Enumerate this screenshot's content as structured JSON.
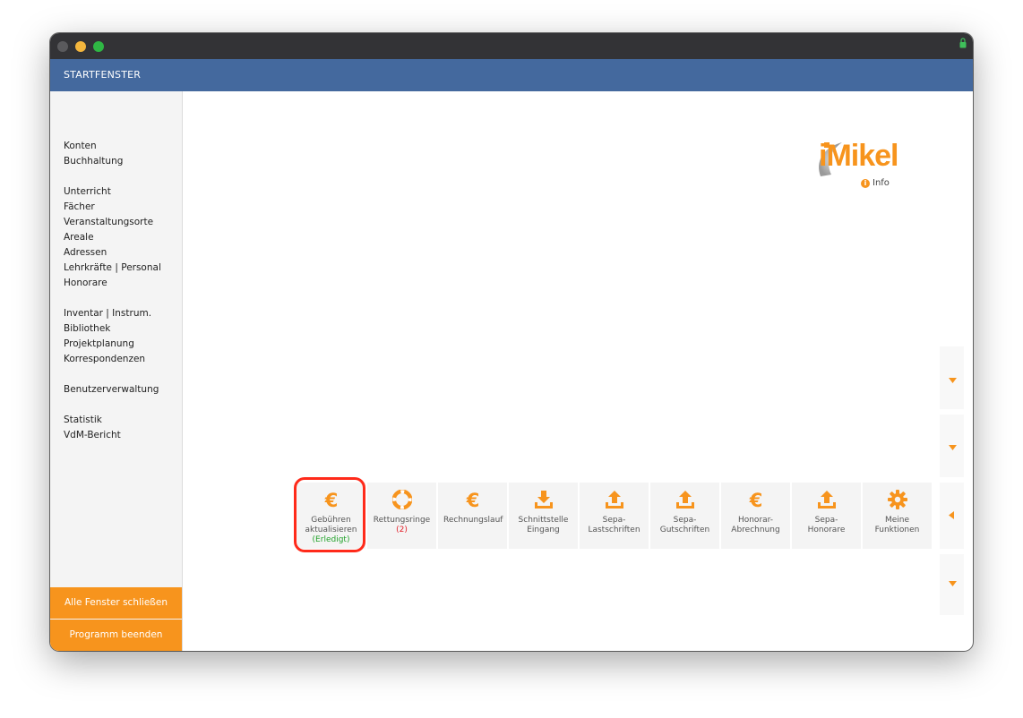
{
  "window": {
    "title": "STARTFENSTER"
  },
  "sidebar": {
    "groups": [
      [
        "Konten",
        "Buchhaltung"
      ],
      [
        "Unterricht",
        "Fächer",
        "Veranstaltungsorte",
        "Areale",
        "Adressen",
        "Lehrkräfte | Personal",
        "Honorare"
      ],
      [
        "Inventar | Instrum.",
        "Bibliothek",
        "Projektplanung",
        "Korrespondenzen"
      ],
      [
        "Benutzerverwaltung"
      ],
      [
        "Statistik",
        "VdM-Bericht"
      ]
    ],
    "close_all": "Alle Fenster schließen",
    "quit": "Programm beenden"
  },
  "logo": {
    "text": "iMikel",
    "info_label": "Info"
  },
  "tiles": [
    {
      "icon": "euro-icon",
      "label": "Gebühren aktualisieren",
      "status": "(Erledigt)",
      "status_type": "ok",
      "highlighted": true
    },
    {
      "icon": "lifebuoy-icon",
      "label": "Rettungsringe",
      "status": "(2)",
      "status_type": "alert"
    },
    {
      "icon": "euro-icon",
      "label": "Rechnungslauf"
    },
    {
      "icon": "download-icon",
      "label": "Schnittstelle Eingang"
    },
    {
      "icon": "upload-icon",
      "label": "Sepa-Lastschriften"
    },
    {
      "icon": "upload-icon",
      "label": "Sepa-Gutschriften"
    },
    {
      "icon": "euro-icon",
      "label": "Honorar-Abrechnung"
    },
    {
      "icon": "upload-icon",
      "label": "Sepa-Honorare"
    },
    {
      "icon": "gear-icon",
      "label": "Meine Funktionen"
    }
  ],
  "colors": {
    "accent": "#f7941d",
    "header": "#44699e",
    "titlebar": "#333336",
    "highlight": "#ff2a1a",
    "ok": "#22a22a",
    "alert": "#e3202a"
  }
}
